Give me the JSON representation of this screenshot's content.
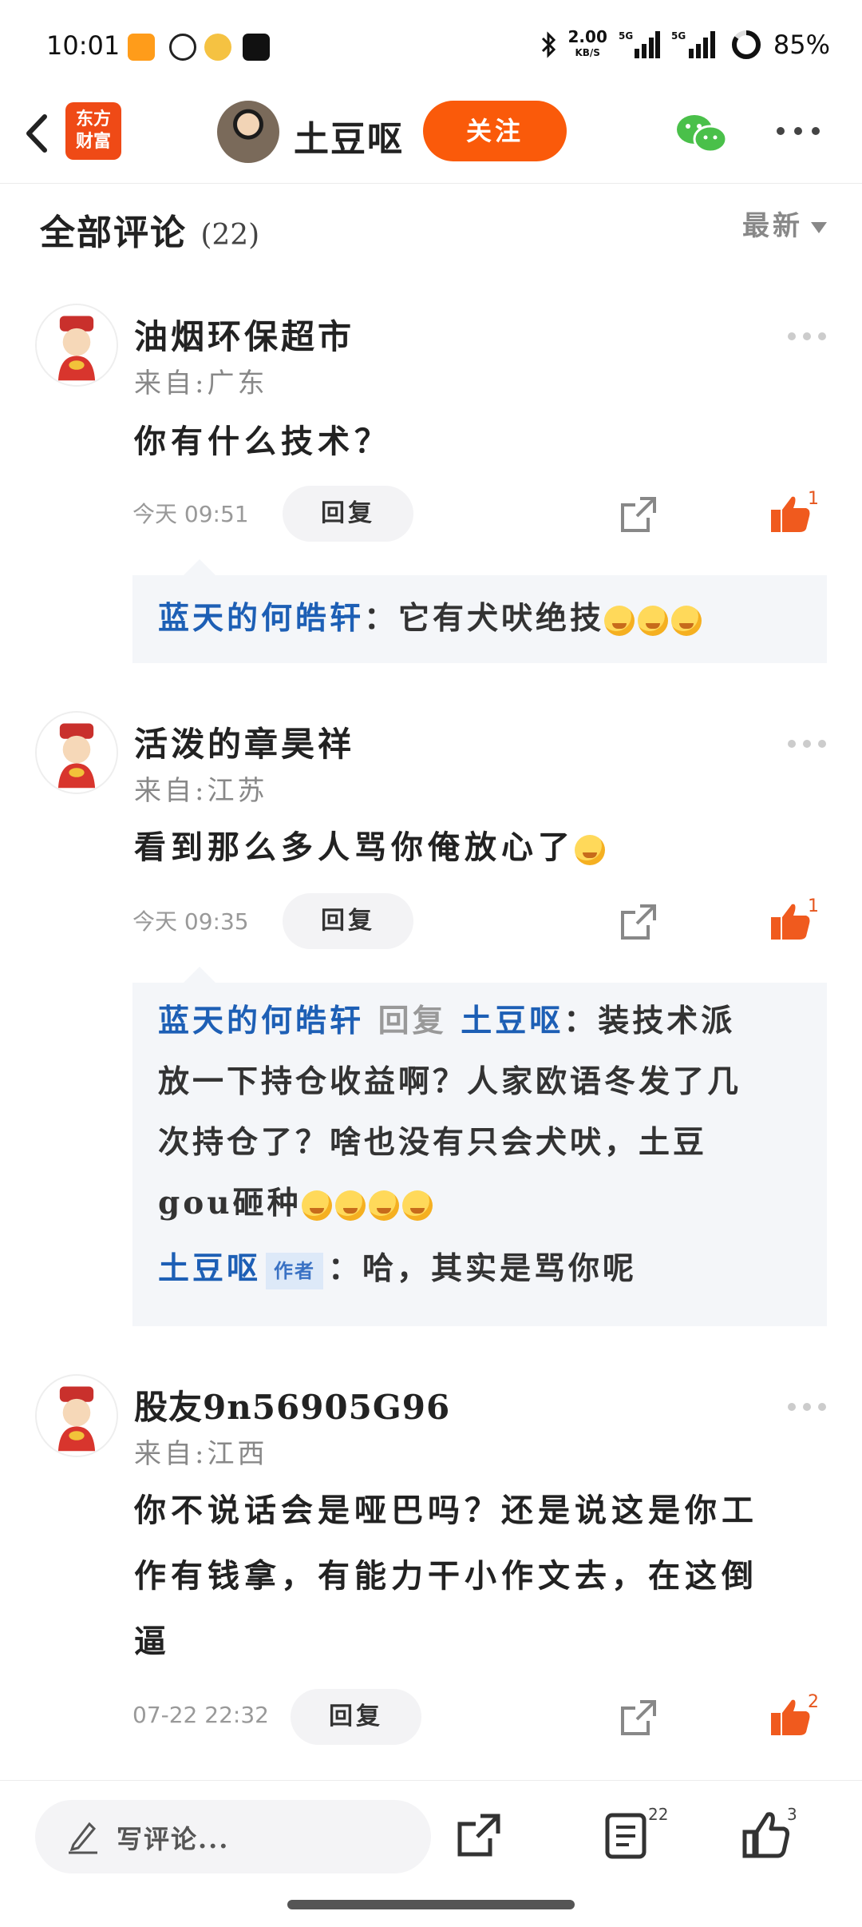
{
  "status_bar": {
    "time": "10:01",
    "net_speed": "2.00",
    "net_unit": "KB/S",
    "signal1": "5G",
    "signal2": "5G",
    "battery": "85%"
  },
  "header": {
    "logo_line1": "东方",
    "logo_line2": "财富",
    "author_name": "土豆呕",
    "follow_label": "关注",
    "brand_color": "#fa5a0a"
  },
  "section": {
    "title": "全部评论",
    "count": "(22)",
    "sort_label": "最新"
  },
  "comments": [
    {
      "name": "油烟环保超市",
      "location": "来自:广东",
      "text": "你有什么技术？",
      "time": "今天 09:51",
      "reply_label": "回复",
      "likes": "1",
      "replies": [
        {
          "user": "蓝天的何皓轩",
          "text": "：它有犬吠绝技"
        }
      ]
    },
    {
      "name": "活泼的章昊祥",
      "location": "来自:江苏",
      "text": "看到那么多人骂你俺放心了",
      "time": "今天 09:35",
      "reply_label": "回复",
      "likes": "1",
      "replies": [
        {
          "user": "蓝天的何皓轩",
          "reply_word": "回复",
          "target": "土豆呕",
          "line1": "：装技术派",
          "line2": "放一下持仓收益啊？人家欧语冬发了几",
          "line3": "次持仓了？啥也没有只会犬吠，土豆",
          "line4": "gou砸种"
        },
        {
          "user": "土豆呕",
          "tag": "作者",
          "text": "：哈，其实是骂你呢"
        }
      ]
    },
    {
      "name": "股友9n56905G96",
      "location": "来自:江西",
      "text_line1": "你不说话会是哑巴吗？还是说这是你工",
      "text_line2": "作有钱拿，有能力干小作文去，在这倒",
      "text_line3": "逼",
      "time": "07-22 22:32",
      "reply_label": "回复",
      "likes": "2"
    }
  ],
  "bottom_bar": {
    "input_placeholder": "写评论...",
    "comment_count": "22",
    "like_count": "3"
  }
}
